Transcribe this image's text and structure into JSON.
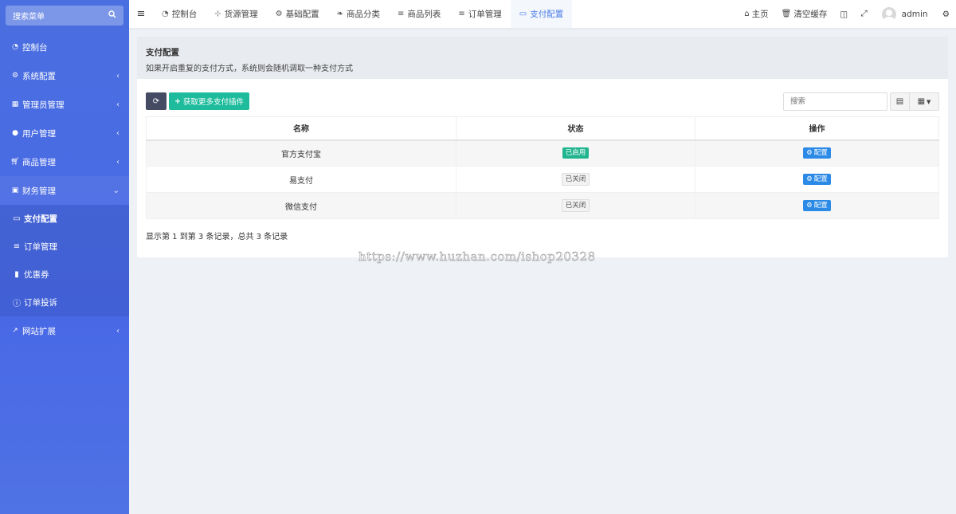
{
  "sidebar": {
    "search_label": "搜索菜单",
    "items": [
      {
        "label": "控制台",
        "icon": "dashboard-icon"
      },
      {
        "label": "系统配置",
        "icon": "cogs-icon"
      },
      {
        "label": "管理员管理",
        "icon": "windows-icon"
      },
      {
        "label": "用户管理",
        "icon": "user-icon"
      },
      {
        "label": "商品管理",
        "icon": "cart-icon"
      },
      {
        "label": "财务管理",
        "icon": "finance-icon"
      },
      {
        "label": "网站扩展",
        "icon": "external-link-icon"
      }
    ],
    "submenu": [
      {
        "label": "支付配置",
        "icon": "credit-card-icon"
      },
      {
        "label": "订单管理",
        "icon": "list-icon"
      },
      {
        "label": "优惠券",
        "icon": "bookmark-icon"
      },
      {
        "label": "订单投诉",
        "icon": "info-icon"
      }
    ]
  },
  "topbar": {
    "tabs": [
      {
        "label": "控制台",
        "icon": "dashboard-icon"
      },
      {
        "label": "货源管理",
        "icon": "sitemap-icon"
      },
      {
        "label": "基础配置",
        "icon": "gear-icon"
      },
      {
        "label": "商品分类",
        "icon": "leaf-icon"
      },
      {
        "label": "商品列表",
        "icon": "list-icon"
      },
      {
        "label": "订单管理",
        "icon": "list-icon"
      },
      {
        "label": "支付配置",
        "icon": "credit-card-icon"
      }
    ],
    "home_label": "主页",
    "clear_cache_label": "清空缓存",
    "username": "admin"
  },
  "panel": {
    "title": "支付配置",
    "description": "如果开启重复的支付方式，系统则会随机调取一种支付方式",
    "add_plugins_label": "获取更多支付插件",
    "search_placeholder": "搜索",
    "columns": [
      "名称",
      "状态",
      "操作"
    ],
    "rows": [
      {
        "name": "官方支付宝",
        "status": "已启用",
        "action": "配置"
      },
      {
        "name": "易支付",
        "status": "已关闭",
        "action": "配置"
      },
      {
        "name": "微信支付",
        "status": "已关闭",
        "action": "配置"
      }
    ],
    "pager_info": "显示第 1 到第 3 条记录，总共 3 条记录"
  },
  "watermark": "https://www.huzhan.com/ishop20328",
  "colors": {
    "sidebar": "#4a6fe0",
    "primary": "#2b8ae6",
    "success": "#1ebc9c",
    "dark_button": "#444b63",
    "active_tab": "#4a7ce8"
  }
}
